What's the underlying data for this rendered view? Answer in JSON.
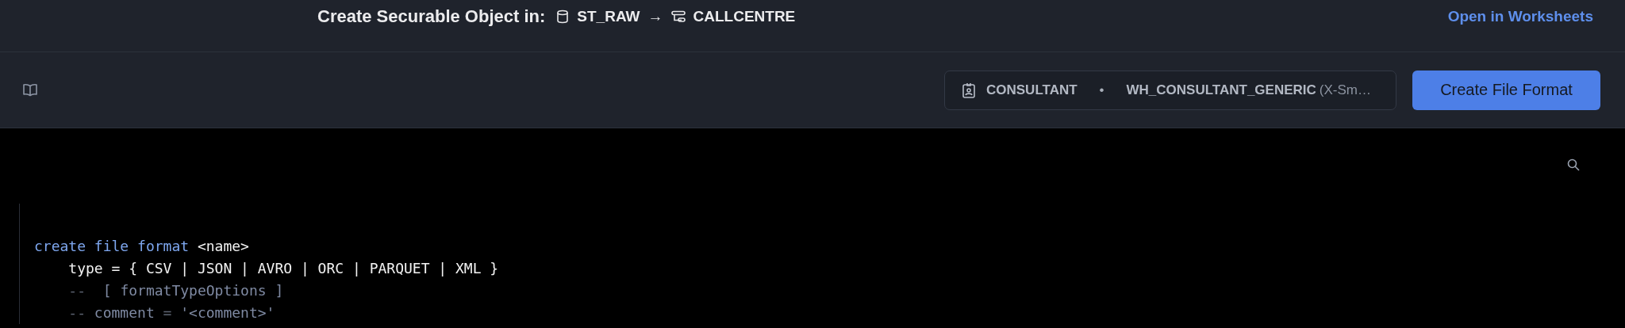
{
  "header": {
    "title": "Create Securable Object in:",
    "database": "ST_RAW",
    "arrow": "→",
    "schema": "CALLCENTRE",
    "link": "Open in Worksheets"
  },
  "toolbar": {
    "role": "CONSULTANT",
    "separator": "•",
    "warehouse": "WH_CONSULTANT_GENERIC",
    "warehouse_size": "(X-Sm…",
    "button": "Create File Format"
  },
  "editor": {
    "lines": [
      [
        {
          "kind": "keyword",
          "text": "create file format"
        },
        {
          "kind": "plain",
          "text": " <name>"
        }
      ],
      [
        {
          "kind": "plain",
          "text": "    type = { CSV | JSON | AVRO | ORC | PARQUET | XML }"
        }
      ],
      [
        {
          "kind": "punct",
          "text": "    --  "
        },
        {
          "kind": "comment",
          "text": "[ formatTypeOptions ]"
        }
      ],
      [
        {
          "kind": "punct",
          "text": "    -- "
        },
        {
          "kind": "comment",
          "text": "comment"
        },
        {
          "kind": "punct",
          "text": " = "
        },
        {
          "kind": "comment",
          "text": "'<comment>'"
        }
      ]
    ]
  }
}
